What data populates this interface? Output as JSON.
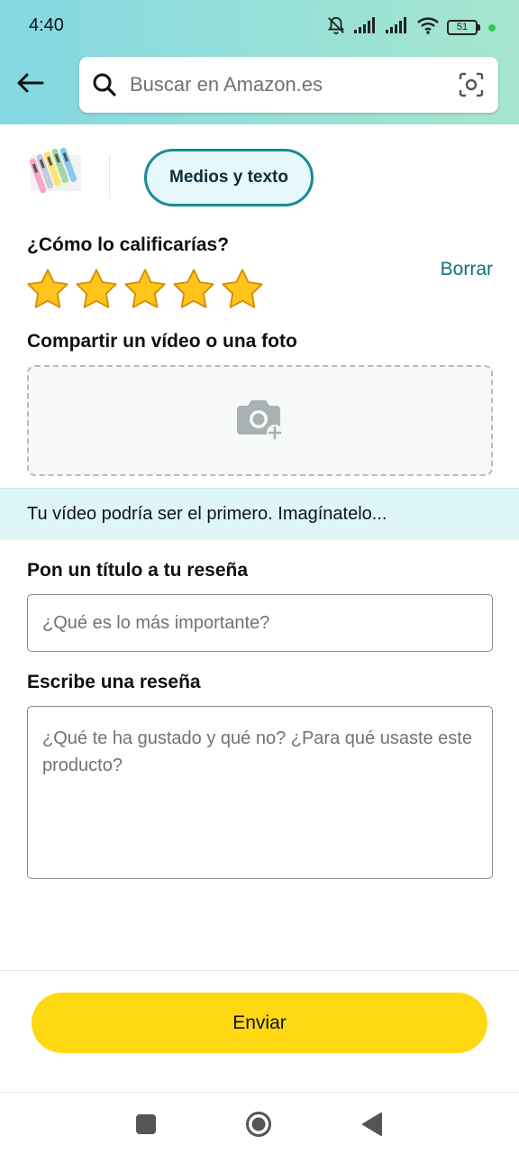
{
  "status_bar": {
    "time": "4:40",
    "battery": "51",
    "icons": [
      "bell-muted-icon",
      "signal-icon",
      "signal-icon",
      "wifi-icon",
      "battery-icon",
      "notification-dot-icon"
    ]
  },
  "search": {
    "placeholder": "Buscar en Amazon.es",
    "icon": "search-icon",
    "camera_icon": "camera-scan-icon"
  },
  "header": {
    "back_icon": "back-arrow-icon"
  },
  "tabs": {
    "active": "Medios y texto"
  },
  "rating": {
    "label": "¿Cómo lo calificarías?",
    "clear_label": "Borrar",
    "value": 5,
    "max": 5,
    "star_color": "#ffc51d"
  },
  "media": {
    "label": "Compartir un vídeo o una foto",
    "icon": "camera-add-icon",
    "banner": "Tu vídeo podría ser el primero. Imagínatelo..."
  },
  "review_title": {
    "label": "Pon un título a tu reseña",
    "placeholder": "¿Qué es lo más importante?"
  },
  "review_body": {
    "label": "Escribe una reseña",
    "placeholder": "¿Qué te ha gustado y qué no? ¿Para qué usaste este producto?"
  },
  "submit": {
    "label": "Enviar",
    "color": "#ffd814"
  },
  "colors": {
    "accent": "#198a97",
    "link": "#11707b",
    "header_gradient_start": "#84d8e3",
    "header_gradient_end": "#a6e6ce"
  },
  "nav_bar": {
    "icons": [
      "recents-square-icon",
      "home-circle-icon",
      "back-triangle-icon"
    ]
  }
}
